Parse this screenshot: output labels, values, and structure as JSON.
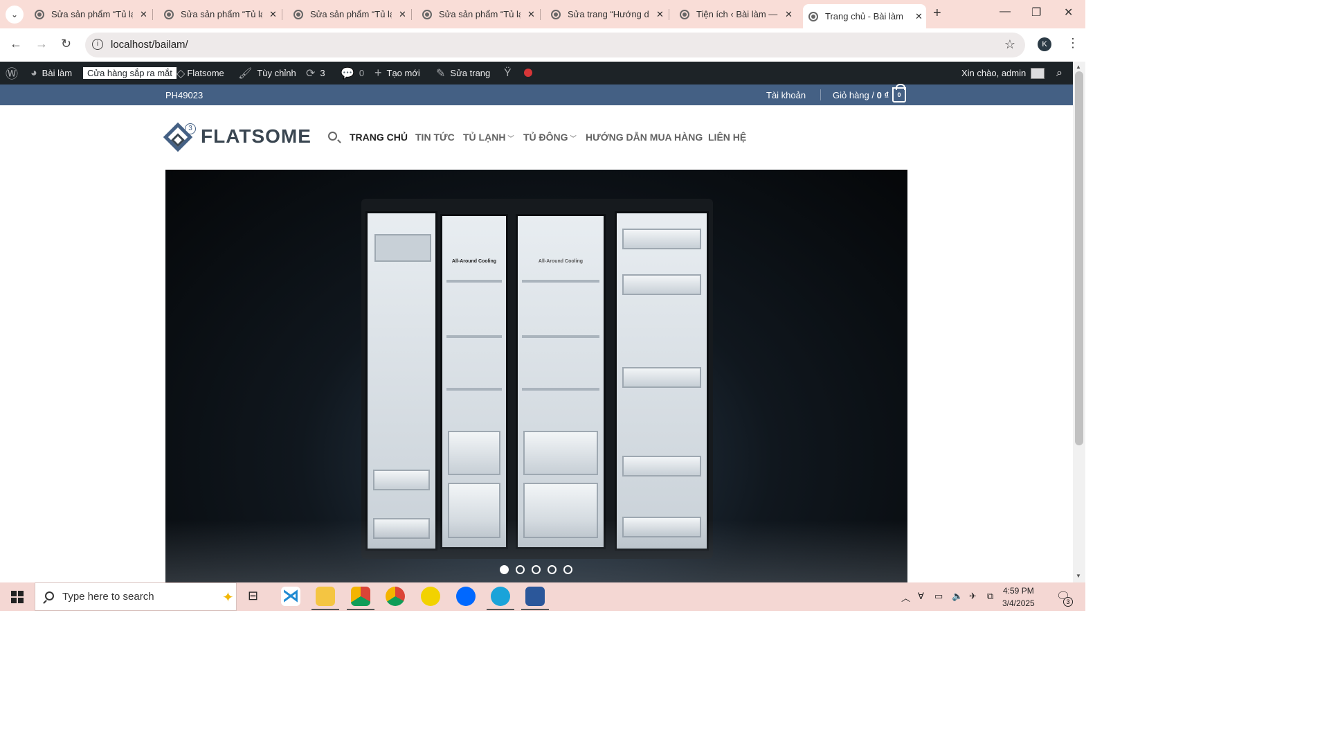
{
  "browser": {
    "tabs": [
      {
        "title": "Sửa sản phẩm “Tủ lạnh"
      },
      {
        "title": "Sửa sản phẩm “Tủ lạnh"
      },
      {
        "title": "Sửa sản phẩm “Tủ lạnh"
      },
      {
        "title": "Sửa sản phẩm “Tủ lạnh"
      },
      {
        "title": "Sửa trang “Hướng dẫn"
      },
      {
        "title": "Tiện ích ‹ Bài làm — W"
      },
      {
        "title": "Trang chủ - Bài làm",
        "active": true
      }
    ],
    "url": "localhost/bailam/",
    "profile_initial": "K"
  },
  "adminbar": {
    "site_name": "Bài làm",
    "coming_soon": "Cửa hàng sắp ra mắt",
    "theme": "Flatsome",
    "customize": "Tùy chỉnh",
    "updates_count": "3",
    "comments_count": "0",
    "new_label": "Tạo mới",
    "edit_page": "Sửa trang",
    "greeting": "Xin chào, admin"
  },
  "topbar": {
    "code": "PH49023",
    "account": "Tài khoản",
    "cart_label": "Giỏ hàng /",
    "cart_amount": "0 ₫",
    "cart_count": "0"
  },
  "header": {
    "logo_text": "FLATSOME",
    "logo_badge": "3",
    "nav": [
      {
        "label": "TRANG CHỦ",
        "active": true
      },
      {
        "label": "TIN TỨC"
      },
      {
        "label": "TỦ LẠNH",
        "dropdown": true
      },
      {
        "label": "TỦ ĐÔNG",
        "dropdown": true
      },
      {
        "label": "HƯỚNG DẪN MUA HÀNG"
      },
      {
        "label": "LIÊN HỆ"
      }
    ]
  },
  "hero": {
    "door_label_left": "All-Around Cooling",
    "door_label_right": "All-Around Cooling",
    "slides_total": 5,
    "active_slide": 1
  },
  "taskbar": {
    "search_placeholder": "Type here to search",
    "time": "4:59 PM",
    "date": "3/4/2025",
    "notification_count": "3"
  },
  "colors": {
    "primary": "#446084",
    "adminbar": "#1d2327",
    "tabstrip": "#f9ddd7"
  }
}
